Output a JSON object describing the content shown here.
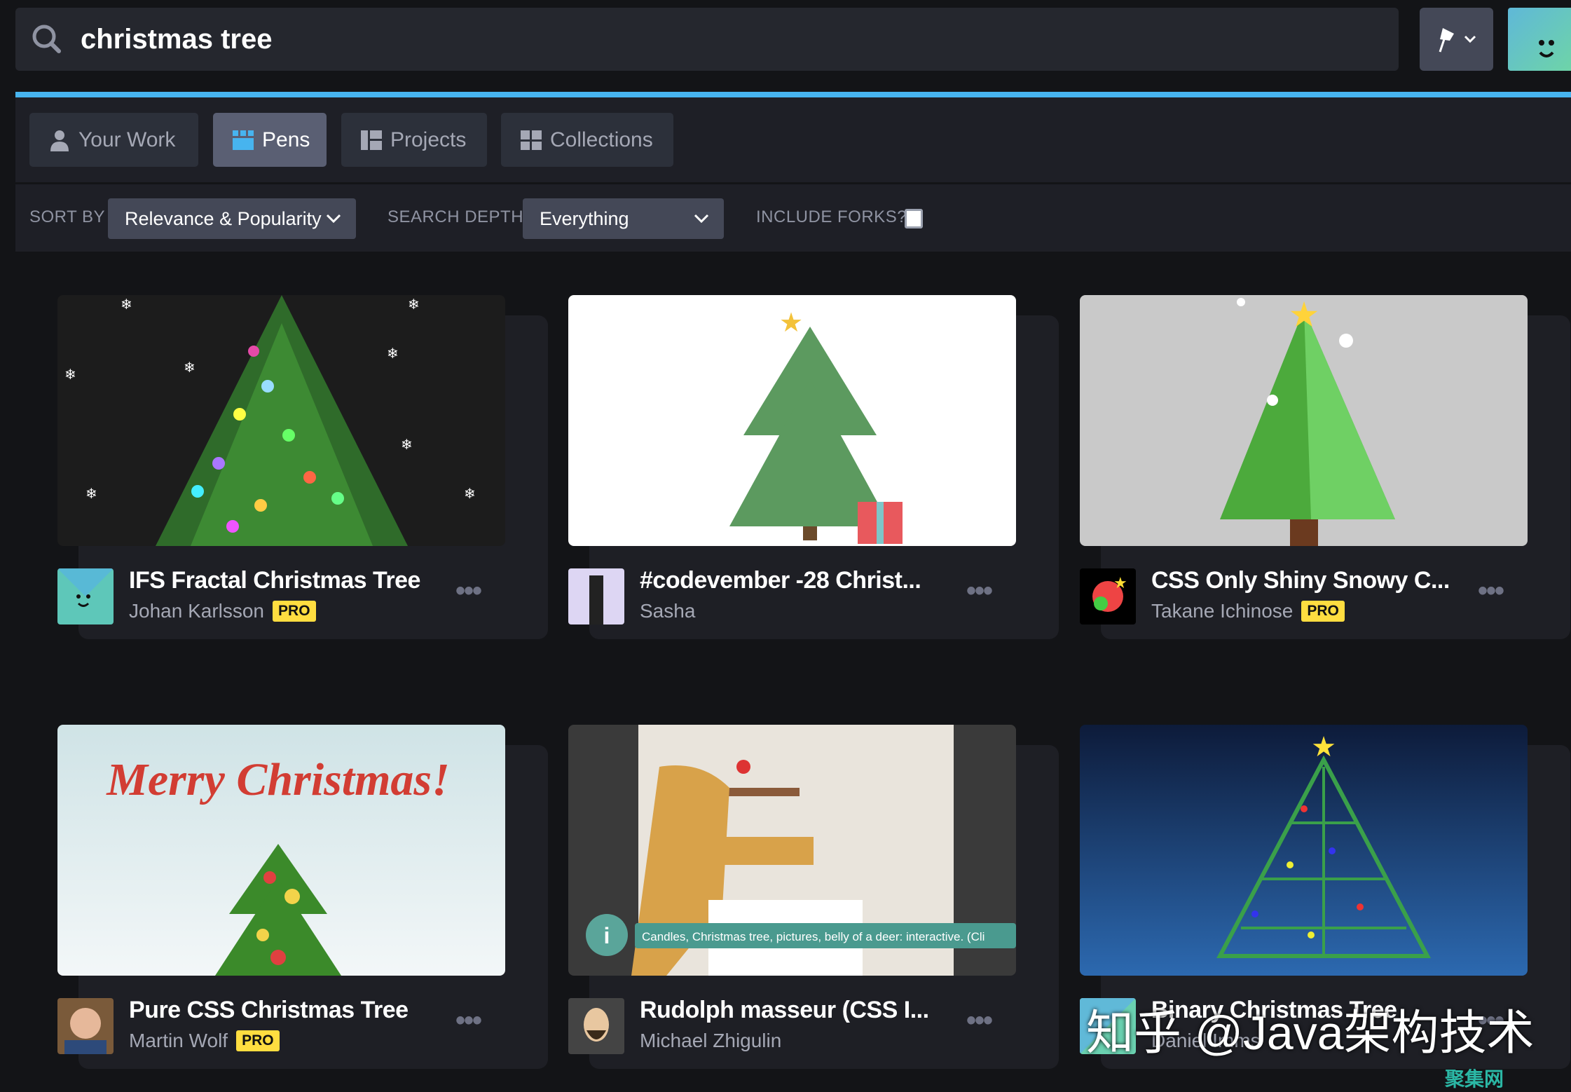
{
  "search": {
    "query": "christmas tree",
    "icon": "search-icon"
  },
  "header": {
    "pin_icon": "pin-icon",
    "accent": "#47b4ef"
  },
  "tabs": [
    {
      "label": "Your Work",
      "icon": "user-icon"
    },
    {
      "label": "Pens",
      "icon": "pens-icon",
      "active": true
    },
    {
      "label": "Projects",
      "icon": "projects-icon"
    },
    {
      "label": "Collections",
      "icon": "collections-icon"
    }
  ],
  "filters": {
    "sort_label": "SORT BY",
    "sort_value": "Relevance & Popularity",
    "depth_label": "SEARCH DEPTH",
    "depth_value": "Everything",
    "forks_label": "INCLUDE FORKS?",
    "forks_checked": false
  },
  "cards": [
    {
      "title": "IFS Fractal Christmas Tree",
      "author": "Johan Karlsson",
      "pro": "PRO"
    },
    {
      "title": "#codevember -28 Christ...",
      "author": "Sasha"
    },
    {
      "title": "CSS Only Shiny Snowy C...",
      "author": "Takane Ichinose",
      "pro": "PRO"
    },
    {
      "title": "Pure CSS Christmas Tree",
      "author": "Martin Wolf",
      "pro": "PRO",
      "thumb_text": "Merry Christmas!"
    },
    {
      "title": "Rudolph masseur (CSS I...",
      "author": "Michael Zhigulin",
      "thumb_caption": "Candles, Christmas tree, pictures, belly of a deer: interactive. (Cli"
    },
    {
      "title": "Binary Christmas Tree",
      "author": "Daniel Imms"
    }
  ],
  "more_label": "•••",
  "watermark": {
    "main": "知乎 @Java架构技术",
    "corner": "聚集网"
  }
}
